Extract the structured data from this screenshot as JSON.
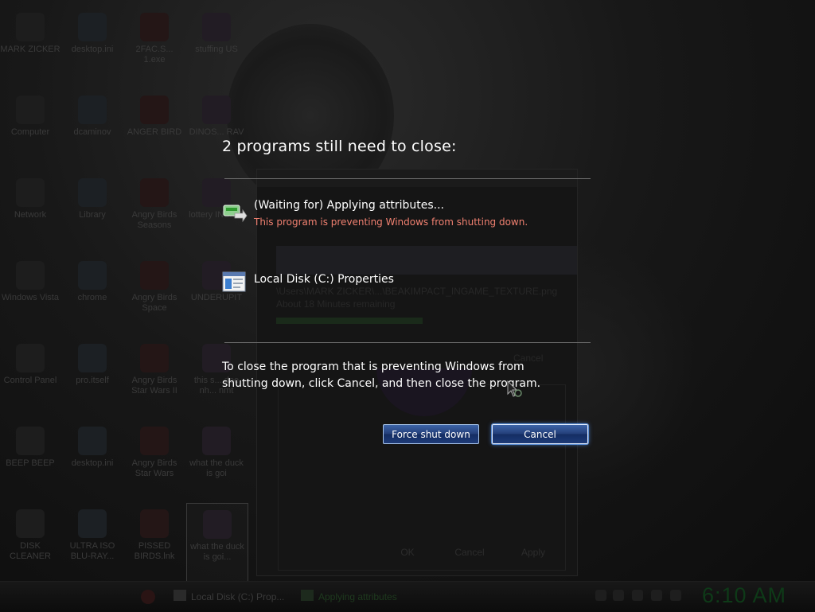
{
  "dialog": {
    "title": "2 programs still need to close:",
    "programs": [
      {
        "name": "(Waiting for) Applying attributes...",
        "status": "This program is preventing Windows from shutting down.",
        "icon": "file-transfer-icon"
      },
      {
        "name": "Local Disk (C:) Properties",
        "status": "",
        "icon": "properties-window-icon"
      }
    ],
    "instructions": "To close the program that is preventing Windows from shutting down, click Cancel, and then close the program.",
    "force_label": "Force shut down",
    "cancel_label": "Cancel"
  },
  "desktop": {
    "icons": [
      {
        "label": "MARK ZICKER"
      },
      {
        "label": "desktop.ini"
      },
      {
        "label": "2FAC.S... 1.exe"
      },
      {
        "label": "stuffing US"
      },
      {
        "label": "Computer"
      },
      {
        "label": "dcaminov"
      },
      {
        "label": "ANGER BIRD"
      },
      {
        "label": "DINOS... RAV"
      },
      {
        "label": "Network"
      },
      {
        "label": "Library"
      },
      {
        "label": "Angry Birds Seasons"
      },
      {
        "label": "lottery INSIDE"
      },
      {
        "label": "Windows Vista"
      },
      {
        "label": "chrome"
      },
      {
        "label": "Angry Birds Space"
      },
      {
        "label": "UNDERUPIT"
      },
      {
        "label": "Control Panel"
      },
      {
        "label": "pro.itself"
      },
      {
        "label": "Angry Birds Star Wars II"
      },
      {
        "label": "this s... doe nh... nmt"
      },
      {
        "label": "BEEP BEEP"
      },
      {
        "label": "desktop.ini"
      },
      {
        "label": "Angry Birds Star Wars"
      },
      {
        "label": "what the duck is goi"
      },
      {
        "label": "DISK CLEANER"
      },
      {
        "label": "ULTRA ISO BLU-RAY..."
      },
      {
        "label": "PISSED BIRDS.lnk"
      },
      {
        "label": "what the duck is goi..."
      }
    ]
  },
  "ghost_window": {
    "path": "\\Users\\MARK ZICKER\\...\\BEAKIMPACT_INGAME_TEXTURE.png",
    "remaining": "About 18 Minutes remaining",
    "cancel": "Cancel",
    "ok": "OK",
    "cancel2": "Cancel",
    "apply": "Apply"
  },
  "taskbar": {
    "items": [
      {
        "label": "Local Disk (C:) Prop...",
        "icon": "folder-icon"
      },
      {
        "label": "Applying attributes",
        "icon": "file-transfer-icon"
      }
    ],
    "clock": "6:10 AM"
  },
  "colors": {
    "button_gradient_top": "#3c64a8",
    "button_gradient_bottom": "#142d63",
    "warning_text": "#f08070",
    "clock_text": "#0e3a18"
  }
}
